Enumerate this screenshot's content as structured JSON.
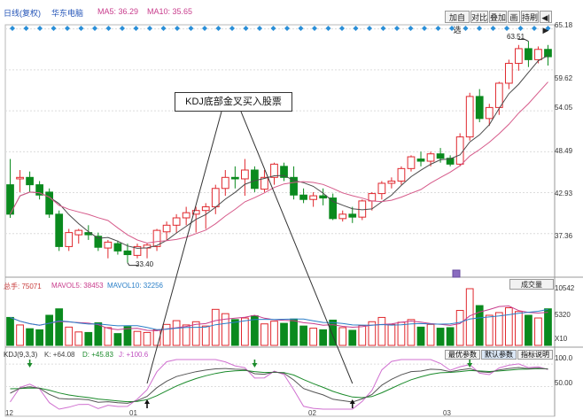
{
  "header": {
    "period": "日线(复权)",
    "stock": "华东电脑",
    "ma5_label": "MA5: 36.29",
    "ma10_label": "MA10: 35.65",
    "buttons": [
      "加自选",
      "对比",
      "叠加",
      "画",
      "持刷"
    ],
    "right_icon": "◀|▶"
  },
  "callout_text": "KDJ底部金叉买入股票",
  "price_axis": [
    "65.18",
    "59.62",
    "54.05",
    "48.49",
    "42.93",
    "37.36"
  ],
  "price_marks": {
    "low": "33.40",
    "high": "63.51"
  },
  "volume": {
    "total": "总手: 75071",
    "mavol5": "MAVOL5: 38453",
    "mavol10": "MAVOL10: 32256",
    "selector": "成交量",
    "axis": [
      "10542",
      "5320",
      "X10"
    ]
  },
  "kdj": {
    "name": "KDJ(9,3,3)",
    "k": "K: +64.08",
    "d": "D: +45.83",
    "j": "J: +100.6",
    "buttons": [
      "最优参数",
      "默认参数",
      "指标说明"
    ],
    "axis": [
      "100.0",
      "50.00"
    ]
  },
  "dates": [
    "12",
    "01",
    "02",
    "03"
  ],
  "colors": {
    "up": "#e0282e",
    "down": "#0a8a1e",
    "ma5": "#4a4a4a",
    "ma10": "#d65a8a",
    "diamond": "#2a8fd8"
  },
  "chart_data": {
    "type": "candlestick",
    "price_ylim": [
      33.0,
      65.5
    ],
    "candles": [
      [
        44,
        47.5,
        39.5,
        40
      ],
      [
        44.8,
        46,
        43,
        45
      ],
      [
        45,
        45.8,
        43,
        44
      ],
      [
        44,
        44.5,
        42,
        42.6
      ],
      [
        43,
        43.5,
        39.5,
        40
      ],
      [
        40,
        40.5,
        35,
        35.6
      ],
      [
        35.6,
        38,
        35,
        37.5
      ],
      [
        37.2,
        38,
        36,
        37.8
      ],
      [
        37.5,
        38.5,
        36.5,
        37.2
      ],
      [
        37,
        37.5,
        35,
        35.5
      ],
      [
        35.4,
        36.5,
        34,
        36.2
      ],
      [
        36,
        36.4,
        34.5,
        35
      ],
      [
        35,
        36,
        33.4,
        34.5
      ],
      [
        34.4,
        36,
        34,
        35.6
      ],
      [
        35.4,
        36,
        34,
        35.8
      ],
      [
        35.6,
        38,
        35,
        37.8
      ],
      [
        37.6,
        39,
        36.5,
        38.5
      ],
      [
        38.5,
        40,
        37.5,
        39.5
      ],
      [
        39.5,
        41,
        38.5,
        40.2
      ],
      [
        40,
        41,
        37.5,
        40.5
      ],
      [
        40.5,
        41.5,
        38,
        41
      ],
      [
        41,
        44,
        40,
        43.5
      ],
      [
        43.5,
        46,
        42.5,
        45
      ],
      [
        45,
        46.5,
        43.5,
        44.8
      ],
      [
        44.8,
        47.5,
        42.5,
        46
      ],
      [
        46,
        46.5,
        43,
        43.5
      ],
      [
        43.4,
        46,
        43,
        45
      ],
      [
        45,
        47,
        44,
        46.8
      ],
      [
        46.5,
        47,
        44.5,
        45
      ],
      [
        45,
        46.5,
        42,
        42.6
      ],
      [
        42.6,
        43.5,
        41.5,
        42
      ],
      [
        42,
        43,
        41,
        42.5
      ],
      [
        42.5,
        43.5,
        41.2,
        42.2
      ],
      [
        42.2,
        42.8,
        39.2,
        39.4
      ],
      [
        39.4,
        40.5,
        39,
        40
      ],
      [
        40,
        41,
        38.8,
        39.6
      ],
      [
        39.6,
        42,
        39.2,
        41.8
      ],
      [
        41.8,
        43,
        40.5,
        42.8
      ],
      [
        42.8,
        44.5,
        42,
        44.2
      ],
      [
        44.2,
        45,
        43.5,
        44.5
      ],
      [
        44.5,
        46.5,
        44,
        46.2
      ],
      [
        46.2,
        48,
        45.8,
        47.8
      ],
      [
        47.5,
        48.5,
        46.5,
        47.2
      ],
      [
        47.2,
        48.5,
        46.5,
        48.2
      ],
      [
        48.2,
        49,
        47,
        47.6
      ],
      [
        47.6,
        48,
        46.5,
        46.8
      ],
      [
        46.8,
        51,
        46.5,
        50.5
      ],
      [
        50.5,
        56.5,
        50,
        56
      ],
      [
        56,
        57,
        52.5,
        53
      ],
      [
        53,
        55,
        52,
        54.5
      ],
      [
        54.5,
        58,
        53.5,
        57.8
      ],
      [
        57.8,
        61,
        57,
        60.5
      ],
      [
        60.5,
        63,
        59.5,
        62.5
      ],
      [
        62.5,
        63.51,
        60,
        61
      ],
      [
        61,
        62.8,
        60.5,
        62.4
      ],
      [
        62.4,
        63,
        60.2,
        61.4
      ]
    ],
    "volume": [
      5200,
      3800,
      3100,
      2900,
      5600,
      6800,
      3400,
      2500,
      2400,
      4200,
      3300,
      2200,
      3500,
      2600,
      2400,
      2900,
      3900,
      4600,
      3800,
      4400,
      3600,
      6700,
      5900,
      4800,
      5100,
      5500,
      4000,
      4500,
      4100,
      4900,
      3600,
      3200,
      2900,
      4700,
      3300,
      2800,
      3700,
      4400,
      5200,
      3900,
      4300,
      4800,
      3400,
      3900,
      3200,
      3300,
      6500,
      10542,
      7400,
      5600,
      6100,
      7000,
      6300,
      5600,
      5100,
      6800
    ],
    "kdj_ylim": [
      0,
      110
    ]
  }
}
